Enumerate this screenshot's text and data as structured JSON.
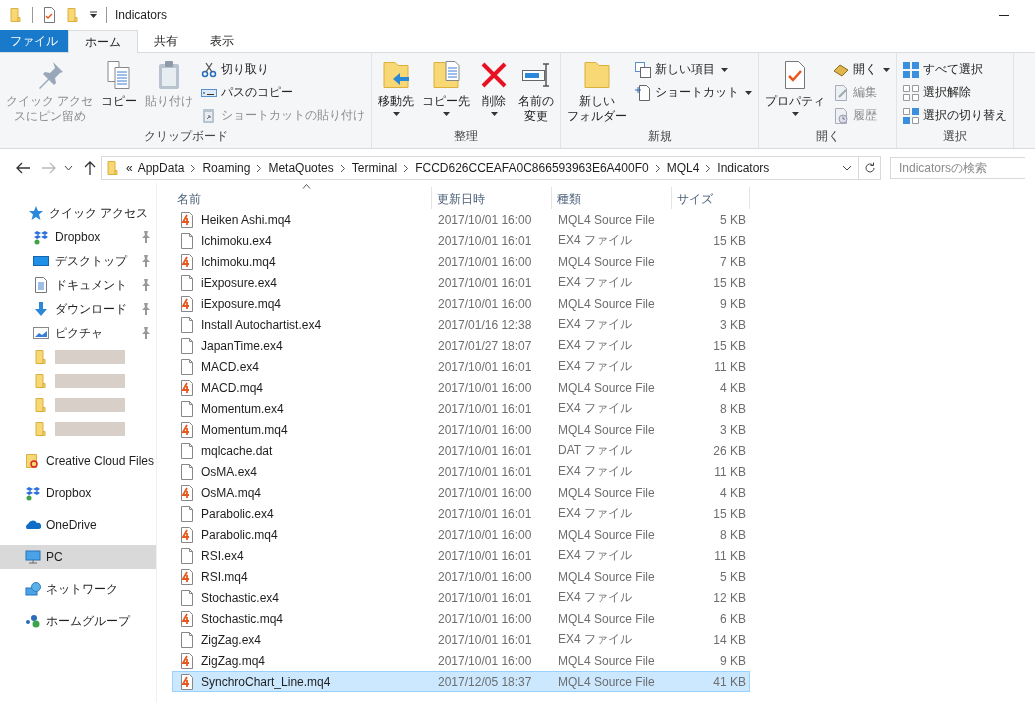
{
  "window": {
    "title": "Indicators"
  },
  "ribbon": {
    "tabs": [
      {
        "label": "ファイル",
        "kind": "file",
        "selected": false
      },
      {
        "label": "ホーム",
        "kind": "tab",
        "selected": true
      },
      {
        "label": "共有",
        "kind": "tab",
        "selected": false
      },
      {
        "label": "表示",
        "kind": "tab",
        "selected": false
      }
    ],
    "groups": [
      {
        "label": "クリップボード",
        "columns": [
          {
            "kind": "large",
            "label": [
              "クイック アクセ",
              "スにピン留め"
            ],
            "disabled": true,
            "dropdown": false
          },
          {
            "kind": "large",
            "label": "コピー",
            "disabled": false,
            "dropdown": false
          },
          {
            "kind": "large",
            "label": "貼り付け",
            "disabled": true,
            "dropdown": false
          },
          {
            "kind": "stack",
            "items": [
              {
                "label": "切り取り",
                "disabled": false,
                "dropdown": false
              },
              {
                "label": "パスのコピー",
                "disabled": false,
                "dropdown": false
              },
              {
                "label": "ショートカットの貼り付け",
                "disabled": true,
                "dropdown": false
              }
            ]
          }
        ]
      },
      {
        "label": "整理",
        "columns": [
          {
            "kind": "large",
            "label": "移動先",
            "disabled": false,
            "dropdown": true
          },
          {
            "kind": "large",
            "label": "コピー先",
            "disabled": false,
            "dropdown": true
          },
          {
            "kind": "large",
            "label": "削除",
            "disabled": false,
            "dropdown": true
          },
          {
            "kind": "large",
            "label": [
              "名前の",
              "変更"
            ],
            "disabled": false,
            "dropdown": false
          }
        ]
      },
      {
        "label": "新規",
        "columns": [
          {
            "kind": "large",
            "label": [
              "新しい",
              "フォルダー"
            ],
            "disabled": false,
            "dropdown": false
          },
          {
            "kind": "stack",
            "items": [
              {
                "label": "新しい項目",
                "disabled": false,
                "dropdown": true
              },
              {
                "label": "ショートカット",
                "disabled": false,
                "dropdown": true
              }
            ]
          }
        ]
      },
      {
        "label": "開く",
        "columns": [
          {
            "kind": "large",
            "label": "プロパティ",
            "disabled": false,
            "dropdown": true
          },
          {
            "kind": "stack",
            "items": [
              {
                "label": "開く",
                "disabled": false,
                "dropdown": true
              },
              {
                "label": "編集",
                "disabled": true,
                "dropdown": false
              },
              {
                "label": "履歴",
                "disabled": true,
                "dropdown": false
              }
            ]
          }
        ]
      },
      {
        "label": "選択",
        "columns": [
          {
            "kind": "stack",
            "items": [
              {
                "label": "すべて選択",
                "disabled": false,
                "dropdown": false
              },
              {
                "label": "選択解除",
                "disabled": false,
                "dropdown": false
              },
              {
                "label": "選択の切り替え",
                "disabled": false,
                "dropdown": false
              }
            ]
          }
        ]
      }
    ]
  },
  "navigation": {
    "back_disabled": false,
    "forward_disabled": true,
    "address": {
      "overflow": "«",
      "crumbs": [
        "AppData",
        "Roaming",
        "MetaQuotes",
        "Terminal",
        "FCCD626CCEAFA0C866593963E6A400F0",
        "MQL4",
        "Indicators"
      ]
    },
    "search": {
      "placeholder": "Indicatorsの検索"
    }
  },
  "sidebar": {
    "items": [
      {
        "label": "クイック アクセス",
        "selected": false,
        "children": [
          {
            "kind": "folder",
            "label": "Dropbox",
            "pinned": true,
            "selected": false
          },
          {
            "kind": "folder",
            "label": "デスクトップ",
            "pinned": true,
            "selected": false
          },
          {
            "kind": "folder",
            "label": "ドキュメント",
            "pinned": true,
            "selected": false
          },
          {
            "kind": "folder",
            "label": "ダウンロード",
            "pinned": true,
            "selected": false
          },
          {
            "kind": "folder",
            "label": "ピクチャ",
            "pinned": true,
            "selected": false
          },
          {
            "kind": "redacted",
            "pinned": false,
            "selected": false
          },
          {
            "kind": "redacted",
            "pinned": false,
            "selected": false
          },
          {
            "kind": "redacted",
            "pinned": false,
            "selected": false
          },
          {
            "kind": "redacted",
            "pinned": false,
            "selected": false
          }
        ]
      },
      {
        "label": "Creative Cloud Files",
        "selected": false
      },
      {
        "label": "Dropbox",
        "selected": false
      },
      {
        "label": "OneDrive",
        "selected": false
      },
      {
        "label": "PC",
        "selected": true
      },
      {
        "label": "ネットワーク",
        "selected": false
      },
      {
        "label": "ホームグループ",
        "selected": false
      }
    ]
  },
  "files": {
    "columns": [
      {
        "label": "名前",
        "sorted": true
      },
      {
        "label": "更新日時",
        "sorted": false
      },
      {
        "label": "種類",
        "sorted": false
      },
      {
        "label": "サイズ",
        "sorted": false
      }
    ],
    "rows": [
      {
        "name": "Heiken Ashi.mq4",
        "modified": "2017/10/01 16:00",
        "type": "MQL4 Source File",
        "size": "5 KB",
        "kind": "source",
        "selected": false
      },
      {
        "name": "Ichimoku.ex4",
        "modified": "2017/10/01 16:01",
        "type": "EX4 ファイル",
        "size": "15 KB",
        "kind": "plain",
        "selected": false
      },
      {
        "name": "Ichimoku.mq4",
        "modified": "2017/10/01 16:00",
        "type": "MQL4 Source File",
        "size": "7 KB",
        "kind": "source",
        "selected": false
      },
      {
        "name": "iExposure.ex4",
        "modified": "2017/10/01 16:01",
        "type": "EX4 ファイル",
        "size": "15 KB",
        "kind": "plain",
        "selected": false
      },
      {
        "name": "iExposure.mq4",
        "modified": "2017/10/01 16:00",
        "type": "MQL4 Source File",
        "size": "9 KB",
        "kind": "source",
        "selected": false
      },
      {
        "name": "Install Autochartist.ex4",
        "modified": "2017/01/16 12:38",
        "type": "EX4 ファイル",
        "size": "3 KB",
        "kind": "plain",
        "selected": false
      },
      {
        "name": "JapanTime.ex4",
        "modified": "2017/01/27 18:07",
        "type": "EX4 ファイル",
        "size": "15 KB",
        "kind": "plain",
        "selected": false
      },
      {
        "name": "MACD.ex4",
        "modified": "2017/10/01 16:01",
        "type": "EX4 ファイル",
        "size": "11 KB",
        "kind": "plain",
        "selected": false
      },
      {
        "name": "MACD.mq4",
        "modified": "2017/10/01 16:00",
        "type": "MQL4 Source File",
        "size": "4 KB",
        "kind": "source",
        "selected": false
      },
      {
        "name": "Momentum.ex4",
        "modified": "2017/10/01 16:01",
        "type": "EX4 ファイル",
        "size": "8 KB",
        "kind": "plain",
        "selected": false
      },
      {
        "name": "Momentum.mq4",
        "modified": "2017/10/01 16:00",
        "type": "MQL4 Source File",
        "size": "3 KB",
        "kind": "source",
        "selected": false
      },
      {
        "name": "mqlcache.dat",
        "modified": "2017/10/01 16:01",
        "type": "DAT ファイル",
        "size": "26 KB",
        "kind": "plain",
        "selected": false
      },
      {
        "name": "OsMA.ex4",
        "modified": "2017/10/01 16:01",
        "type": "EX4 ファイル",
        "size": "11 KB",
        "kind": "plain",
        "selected": false
      },
      {
        "name": "OsMA.mq4",
        "modified": "2017/10/01 16:00",
        "type": "MQL4 Source File",
        "size": "4 KB",
        "kind": "source",
        "selected": false
      },
      {
        "name": "Parabolic.ex4",
        "modified": "2017/10/01 16:01",
        "type": "EX4 ファイル",
        "size": "15 KB",
        "kind": "plain",
        "selected": false
      },
      {
        "name": "Parabolic.mq4",
        "modified": "2017/10/01 16:00",
        "type": "MQL4 Source File",
        "size": "8 KB",
        "kind": "source",
        "selected": false
      },
      {
        "name": "RSI.ex4",
        "modified": "2017/10/01 16:01",
        "type": "EX4 ファイル",
        "size": "11 KB",
        "kind": "plain",
        "selected": false
      },
      {
        "name": "RSI.mq4",
        "modified": "2017/10/01 16:00",
        "type": "MQL4 Source File",
        "size": "5 KB",
        "kind": "source",
        "selected": false
      },
      {
        "name": "Stochastic.ex4",
        "modified": "2017/10/01 16:01",
        "type": "EX4 ファイル",
        "size": "12 KB",
        "kind": "plain",
        "selected": false
      },
      {
        "name": "Stochastic.mq4",
        "modified": "2017/10/01 16:00",
        "type": "MQL4 Source File",
        "size": "6 KB",
        "kind": "source",
        "selected": false
      },
      {
        "name": "ZigZag.ex4",
        "modified": "2017/10/01 16:01",
        "type": "EX4 ファイル",
        "size": "14 KB",
        "kind": "plain",
        "selected": false
      },
      {
        "name": "ZigZag.mq4",
        "modified": "2017/10/01 16:00",
        "type": "MQL4 Source File",
        "size": "9 KB",
        "kind": "source",
        "selected": false
      },
      {
        "name": "SynchroChart_Line.mq4",
        "modified": "2017/12/05 18:37",
        "type": "MQL4 Source File",
        "size": "41 KB",
        "kind": "source",
        "selected": true
      }
    ]
  }
}
